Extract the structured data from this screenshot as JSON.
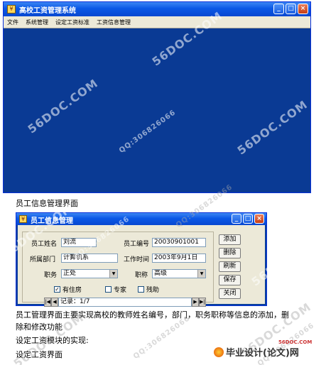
{
  "main_window": {
    "title": "高校工资管理系统",
    "menu": [
      "文件",
      "系统管理",
      "设定工资标准",
      "工资信息管理"
    ],
    "controls": [
      "_",
      "□",
      "×"
    ]
  },
  "caption1": "员工信息管理界面",
  "dialog": {
    "title": "员工信息管理",
    "controls": [
      "_",
      "□",
      "×"
    ],
    "labels": {
      "name": "员工姓名",
      "id": "员工编号",
      "dept": "所属部门",
      "work_time": "工作时间",
      "position": "职务",
      "title": "职称"
    },
    "values": {
      "name": "刘流",
      "id": "20030901001",
      "dept": "计算机系",
      "work_time": "2003年9月1日",
      "position": "正处",
      "title": "高级"
    },
    "checks": [
      {
        "label": "有住房",
        "checked": true
      },
      {
        "label": "专家",
        "checked": false
      },
      {
        "label": "残助",
        "checked": false
      }
    ],
    "record": "记录：1/7",
    "buttons": [
      "添加",
      "删除",
      "刷新",
      "保存",
      "关闭"
    ]
  },
  "paragraphs": [
    "员工管理界面主要实现高校的教师姓名编号，部门，职务职称等信息的添加，删",
    "除和修改功能",
    "设定工资模块的实现:",
    "设定工资界面"
  ],
  "watermarks": [
    "56DOC.COM",
    "QQ:306826066"
  ],
  "footer": {
    "site": "56DOC.COM",
    "logo_text": "毕业设计(论文)网"
  }
}
